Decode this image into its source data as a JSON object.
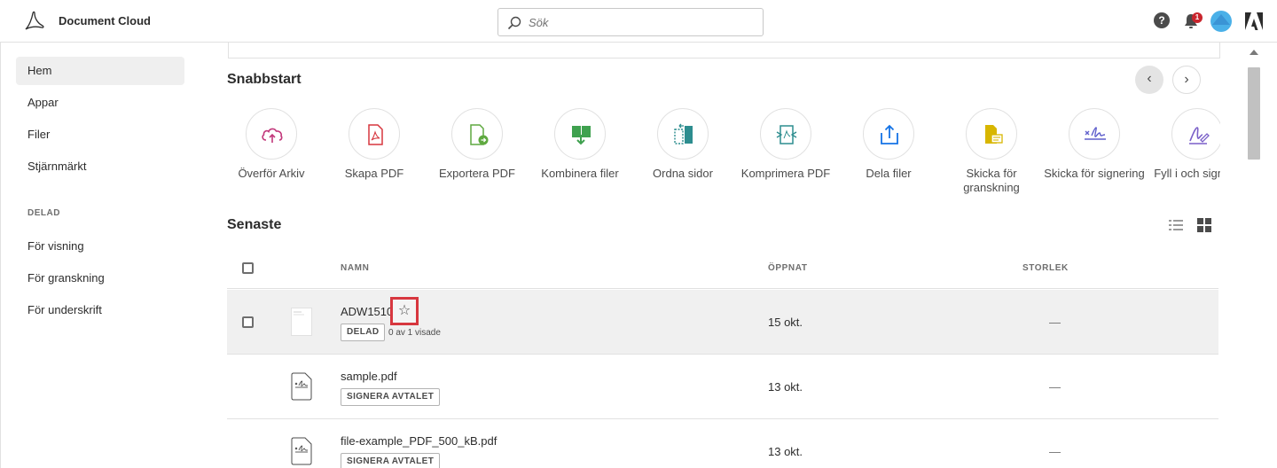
{
  "header": {
    "brand": "Document Cloud",
    "search_placeholder": "Sök",
    "notification_count": "1",
    "help_glyph": "?"
  },
  "sidebar": {
    "items": [
      {
        "label": "Hem",
        "active": true
      },
      {
        "label": "Appar"
      },
      {
        "label": "Filer"
      },
      {
        "label": "Stjärnmärkt"
      }
    ],
    "shared_heading": "DELAD",
    "shared_items": [
      {
        "label": "För visning"
      },
      {
        "label": "För granskning"
      },
      {
        "label": "För underskrift"
      }
    ]
  },
  "quickstart": {
    "title": "Snabbstart",
    "tools": [
      {
        "label": "Överför Arkiv",
        "icon": "upload-cloud-icon",
        "color": "#c2387b"
      },
      {
        "label": "Skapa PDF",
        "icon": "create-pdf-icon",
        "color": "#d7373f"
      },
      {
        "label": "Exportera PDF",
        "icon": "export-pdf-icon",
        "color": "#5fa940"
      },
      {
        "label": "Kombinera filer",
        "icon": "combine-files-icon",
        "color": "#3fa14f"
      },
      {
        "label": "Ordna sidor",
        "icon": "organize-pages-icon",
        "color": "#2d8d8f"
      },
      {
        "label": "Komprimera PDF",
        "icon": "compress-pdf-icon",
        "color": "#2d8d8f"
      },
      {
        "label": "Dela filer",
        "icon": "share-files-icon",
        "color": "#1473e6"
      },
      {
        "label": "Skicka för granskning",
        "icon": "send-review-icon",
        "color": "#d8b600"
      },
      {
        "label": "Skicka för signering",
        "icon": "send-sign-icon",
        "color": "#5f5fcc"
      },
      {
        "label": "Fyll i och signera",
        "icon": "fill-sign-icon",
        "color": "#7a5fc8"
      }
    ]
  },
  "recent": {
    "title": "Senaste",
    "columns": {
      "name": "NAMN",
      "opened": "ÖPPNAT",
      "size": "STORLEK"
    },
    "rows": [
      {
        "name": "ADW1510",
        "tag": "DELAD",
        "meta": "0 av 1 visade",
        "opened": "15 okt.",
        "size": "—",
        "selected": true
      },
      {
        "name": "sample.pdf",
        "tag": "SIGNERA AVTALET",
        "opened": "13 okt.",
        "size": "—"
      },
      {
        "name": "file-example_PDF_500_kB.pdf",
        "tag": "SIGNERA AVTALET",
        "opened": "13 okt.",
        "size": "—"
      }
    ]
  }
}
